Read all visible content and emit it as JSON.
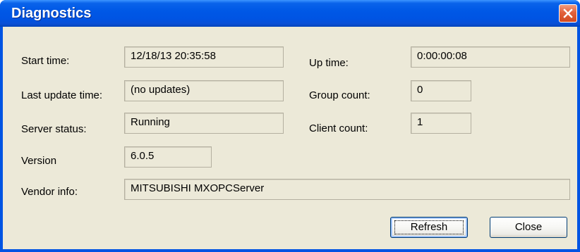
{
  "window": {
    "title": "Diagnostics"
  },
  "fields": {
    "start_time": {
      "label": "Start time:",
      "value": "12/18/13 20:35:58"
    },
    "last_update_time": {
      "label": "Last update time:",
      "value": "(no updates)"
    },
    "server_status": {
      "label": "Server status:",
      "value": "Running"
    },
    "version": {
      "label": "Version",
      "value": "6.0.5"
    },
    "vendor_info": {
      "label": "Vendor info:",
      "value": "MITSUBISHI MXOPCServer"
    },
    "up_time": {
      "label": "Up time:",
      "value": "0:00:00:08"
    },
    "group_count": {
      "label": "Group count:",
      "value": "0"
    },
    "client_count": {
      "label": "Client count:",
      "value": "1"
    }
  },
  "buttons": {
    "refresh": "Refresh",
    "close": "Close"
  },
  "icons": {
    "close": "close-icon"
  },
  "colors": {
    "titlebar": "#0054e3",
    "client_background": "#ece9d8",
    "close_button": "#e2613c"
  }
}
